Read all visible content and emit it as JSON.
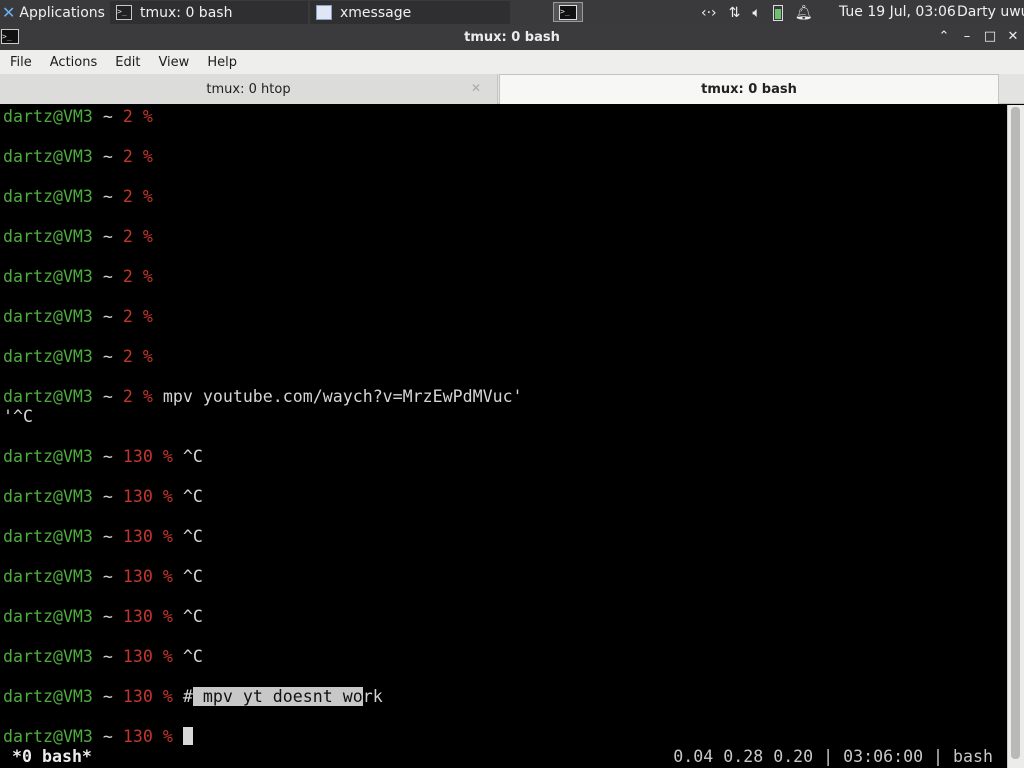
{
  "panel": {
    "applications_label": "Applications",
    "applications_suffix": "☰",
    "tasks": [
      {
        "label": "tmux: 0 bash",
        "icon": "terminal-icon"
      },
      {
        "label": "xmessage",
        "icon": "window-icon"
      }
    ],
    "tray_icons": [
      "network-icon",
      "transfer-icon",
      "volume-icon",
      "battery-icon",
      "notification-bell-icon"
    ],
    "clock": "Tue 19 Jul, 03:06",
    "user": "Darty uwu"
  },
  "window": {
    "title": "tmux: 0 bash",
    "controls": {
      "shade": "⌃",
      "minimize": "–",
      "maximize": "□",
      "close": "✕"
    }
  },
  "menu": [
    "File",
    "Actions",
    "Edit",
    "View",
    "Help"
  ],
  "tabs": [
    {
      "label": "tmux: 0 htop",
      "active": false,
      "close": "✕"
    },
    {
      "label": "tmux: 0 bash",
      "active": true
    }
  ],
  "terminal": {
    "prompt_user": "dartz@VM3",
    "prompt_path": "~",
    "lines": [
      {
        "code": "2",
        "cmd": ""
      },
      {
        "code": "2",
        "cmd": ""
      },
      {
        "code": "2",
        "cmd": ""
      },
      {
        "code": "2",
        "cmd": ""
      },
      {
        "code": "2",
        "cmd": ""
      },
      {
        "code": "2",
        "cmd": ""
      },
      {
        "code": "2",
        "cmd": ""
      },
      {
        "code": "2",
        "cmd": "mpv youtube.com/waych?v=MrzEwPdMVuc'",
        "continuation": "'^C"
      },
      {
        "code": "130",
        "cmd": "^C"
      },
      {
        "code": "130",
        "cmd": "^C"
      },
      {
        "code": "130",
        "cmd": "^C"
      },
      {
        "code": "130",
        "cmd": "^C"
      },
      {
        "code": "130",
        "cmd": "^C"
      },
      {
        "code": "130",
        "cmd": "^C"
      },
      {
        "code": "130",
        "cmd_pre": "#",
        "cmd_selected": " mpv yt doesnt wo",
        "cmd_post": "rk"
      },
      {
        "code": "130",
        "cmd": "",
        "cursor": true
      }
    ],
    "status_left": "*0 bash*",
    "status_right": "0.04 0.28 0.20 | 03:06:00 | bash"
  }
}
